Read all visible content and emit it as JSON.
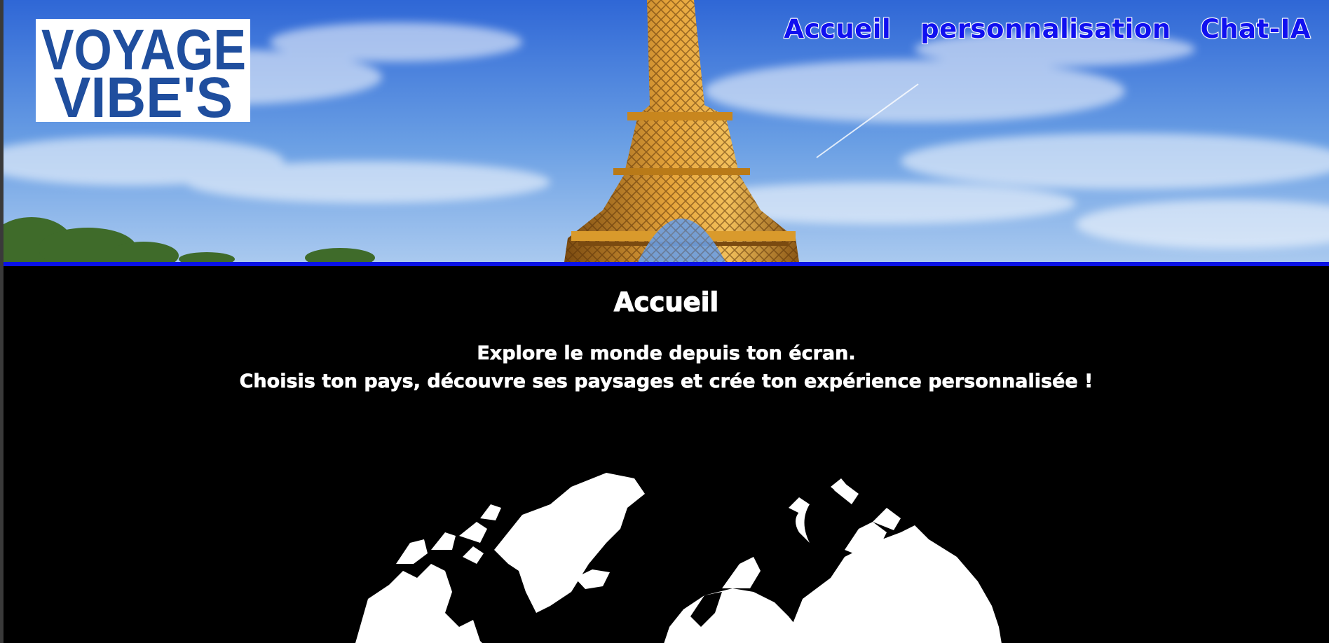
{
  "header": {
    "logo": {
      "text_line1": "VOYAGE",
      "text_line2": "VIBE'S",
      "color": "#1f4e9e"
    },
    "nav": [
      {
        "label": "Accueil"
      },
      {
        "label": "personnalisation"
      },
      {
        "label": "Chat-IA"
      }
    ],
    "nav_color": "#1010f0",
    "accent_border_color": "#0a12e6"
  },
  "main": {
    "title": "Accueil",
    "intro_line1": "Explore le monde depuis ton écran.",
    "intro_line2": "Choisis ton pays, découvre ses paysages et crée ton expérience personnalisée !",
    "background_color": "#000000",
    "map_icon": "world-map-icon"
  }
}
